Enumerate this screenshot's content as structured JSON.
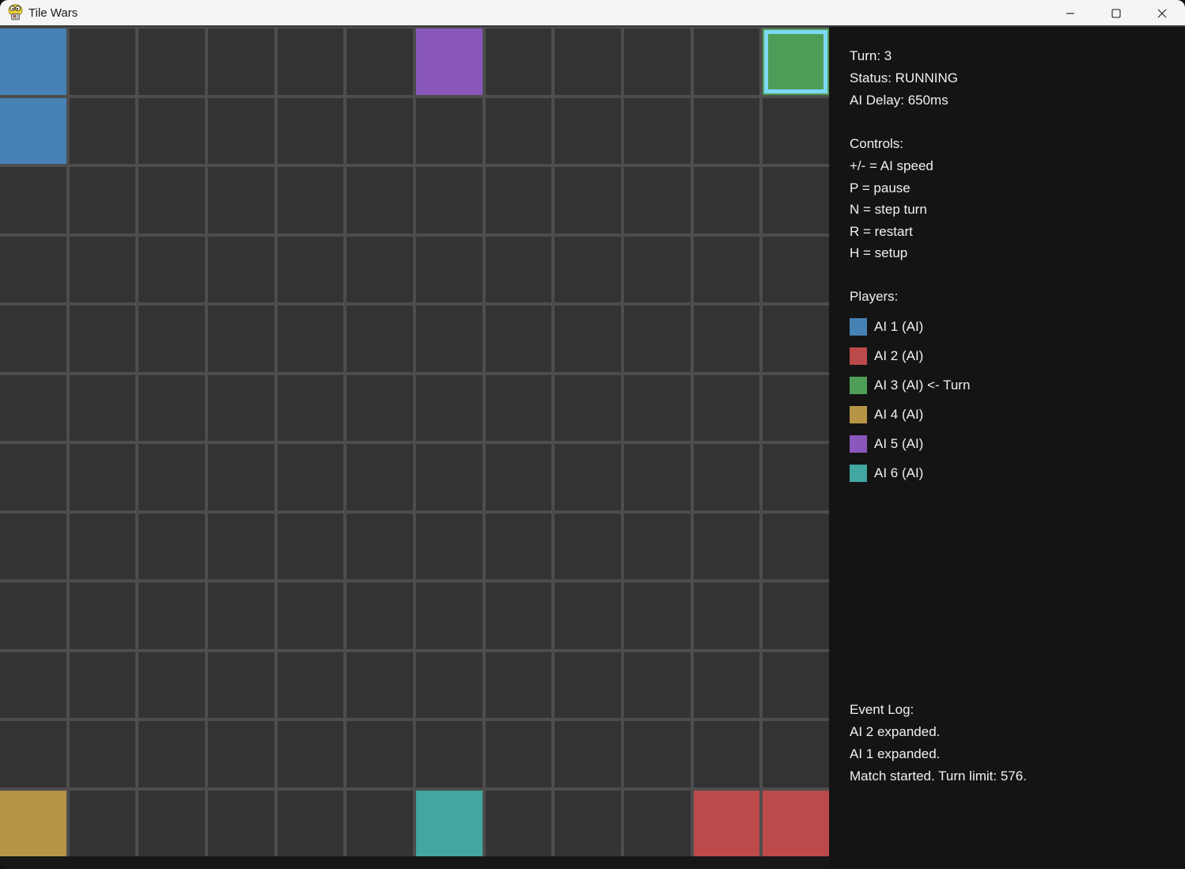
{
  "window": {
    "title": "Tile Wars",
    "app_icon": "pygame-snake",
    "buttons": {
      "minimize": "minimize",
      "maximize": "maximize",
      "close": "close"
    }
  },
  "panel": {
    "stats": {
      "turn": "Turn: 3",
      "status": "Status: RUNNING",
      "ai_delay": "AI Delay: 650ms"
    },
    "controls": {
      "header": "Controls:",
      "items": [
        "+/- = AI speed",
        "P = pause",
        "N = step turn",
        "R = restart",
        "H = setup"
      ]
    },
    "players": {
      "header": "Players:",
      "items": [
        {
          "label": "AI 1 (AI)",
          "color": "#4682b4",
          "is_turn": false
        },
        {
          "label": "AI 2 (AI)",
          "color": "#bd4a4a",
          "is_turn": false
        },
        {
          "label": "AI 3 (AI) <- Turn",
          "color": "#4f9e58",
          "is_turn": true
        },
        {
          "label": "AI 4 (AI)",
          "color": "#b69546",
          "is_turn": false
        },
        {
          "label": "AI 5 (AI)",
          "color": "#8a58bb",
          "is_turn": false
        },
        {
          "label": "AI 6 (AI)",
          "color": "#42a6a1",
          "is_turn": false
        }
      ]
    },
    "event_log": {
      "header": "Event Log:",
      "items": [
        "AI 2 expanded.",
        "AI 1 expanded.",
        "Match started. Turn limit: 576."
      ]
    }
  },
  "board": {
    "rows": 12,
    "cols": 12,
    "colors": {
      "empty_tile": "#333333",
      "grid_lines": "#4d4d4d",
      "turn_highlight": "#7ed9f5"
    },
    "tiles": [
      {
        "row": 0,
        "col": 0,
        "player": "AI 1",
        "color": "#4682b4",
        "highlighted": false
      },
      {
        "row": 1,
        "col": 0,
        "player": "AI 1",
        "color": "#4682b4",
        "highlighted": false
      },
      {
        "row": 0,
        "col": 6,
        "player": "AI 5",
        "color": "#8a58bb",
        "highlighted": false
      },
      {
        "row": 0,
        "col": 11,
        "player": "AI 3",
        "color": "#4f9e58",
        "highlighted": true
      },
      {
        "row": 11,
        "col": 0,
        "player": "AI 4",
        "color": "#b69546",
        "highlighted": false
      },
      {
        "row": 11,
        "col": 6,
        "player": "AI 6",
        "color": "#42a6a1",
        "highlighted": false
      },
      {
        "row": 11,
        "col": 10,
        "player": "AI 2",
        "color": "#bd4a4a",
        "highlighted": false
      },
      {
        "row": 11,
        "col": 11,
        "player": "AI 2",
        "color": "#bd4a4a",
        "highlighted": false
      }
    ]
  }
}
